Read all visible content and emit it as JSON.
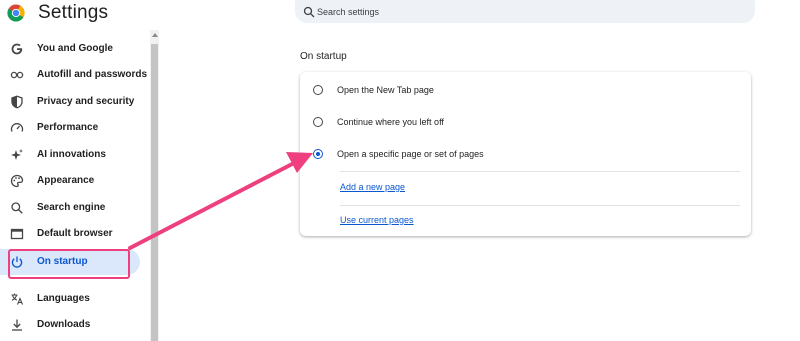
{
  "header": {
    "title": "Settings",
    "search_placeholder": "Search settings"
  },
  "sidebar": {
    "items": [
      {
        "label": "You and Google",
        "icon": "google-g-icon"
      },
      {
        "label": "Autofill and passwords",
        "icon": "key-icon"
      },
      {
        "label": "Privacy and security",
        "icon": "shield-icon"
      },
      {
        "label": "Performance",
        "icon": "speedometer-icon"
      },
      {
        "label": "AI innovations",
        "icon": "sparkle-icon"
      },
      {
        "label": "Appearance",
        "icon": "palette-icon"
      },
      {
        "label": "Search engine",
        "icon": "search-icon"
      },
      {
        "label": "Default browser",
        "icon": "browser-window-icon"
      },
      {
        "label": "On startup",
        "icon": "power-icon",
        "active": true
      },
      {
        "label": "Languages",
        "icon": "translate-icon"
      },
      {
        "label": "Downloads",
        "icon": "download-icon"
      }
    ]
  },
  "main": {
    "section_title": "On startup",
    "options": [
      {
        "label": "Open the New Tab page",
        "selected": false
      },
      {
        "label": "Continue where you left off",
        "selected": false
      },
      {
        "label": "Open a specific page or set of pages",
        "selected": true
      }
    ],
    "links": {
      "add_page": "Add a new page",
      "use_current": "Use current pages"
    }
  },
  "colors": {
    "accent": "#0b57d0",
    "annotation": "#ee3f7f",
    "active_bg": "#dbe8fb"
  }
}
